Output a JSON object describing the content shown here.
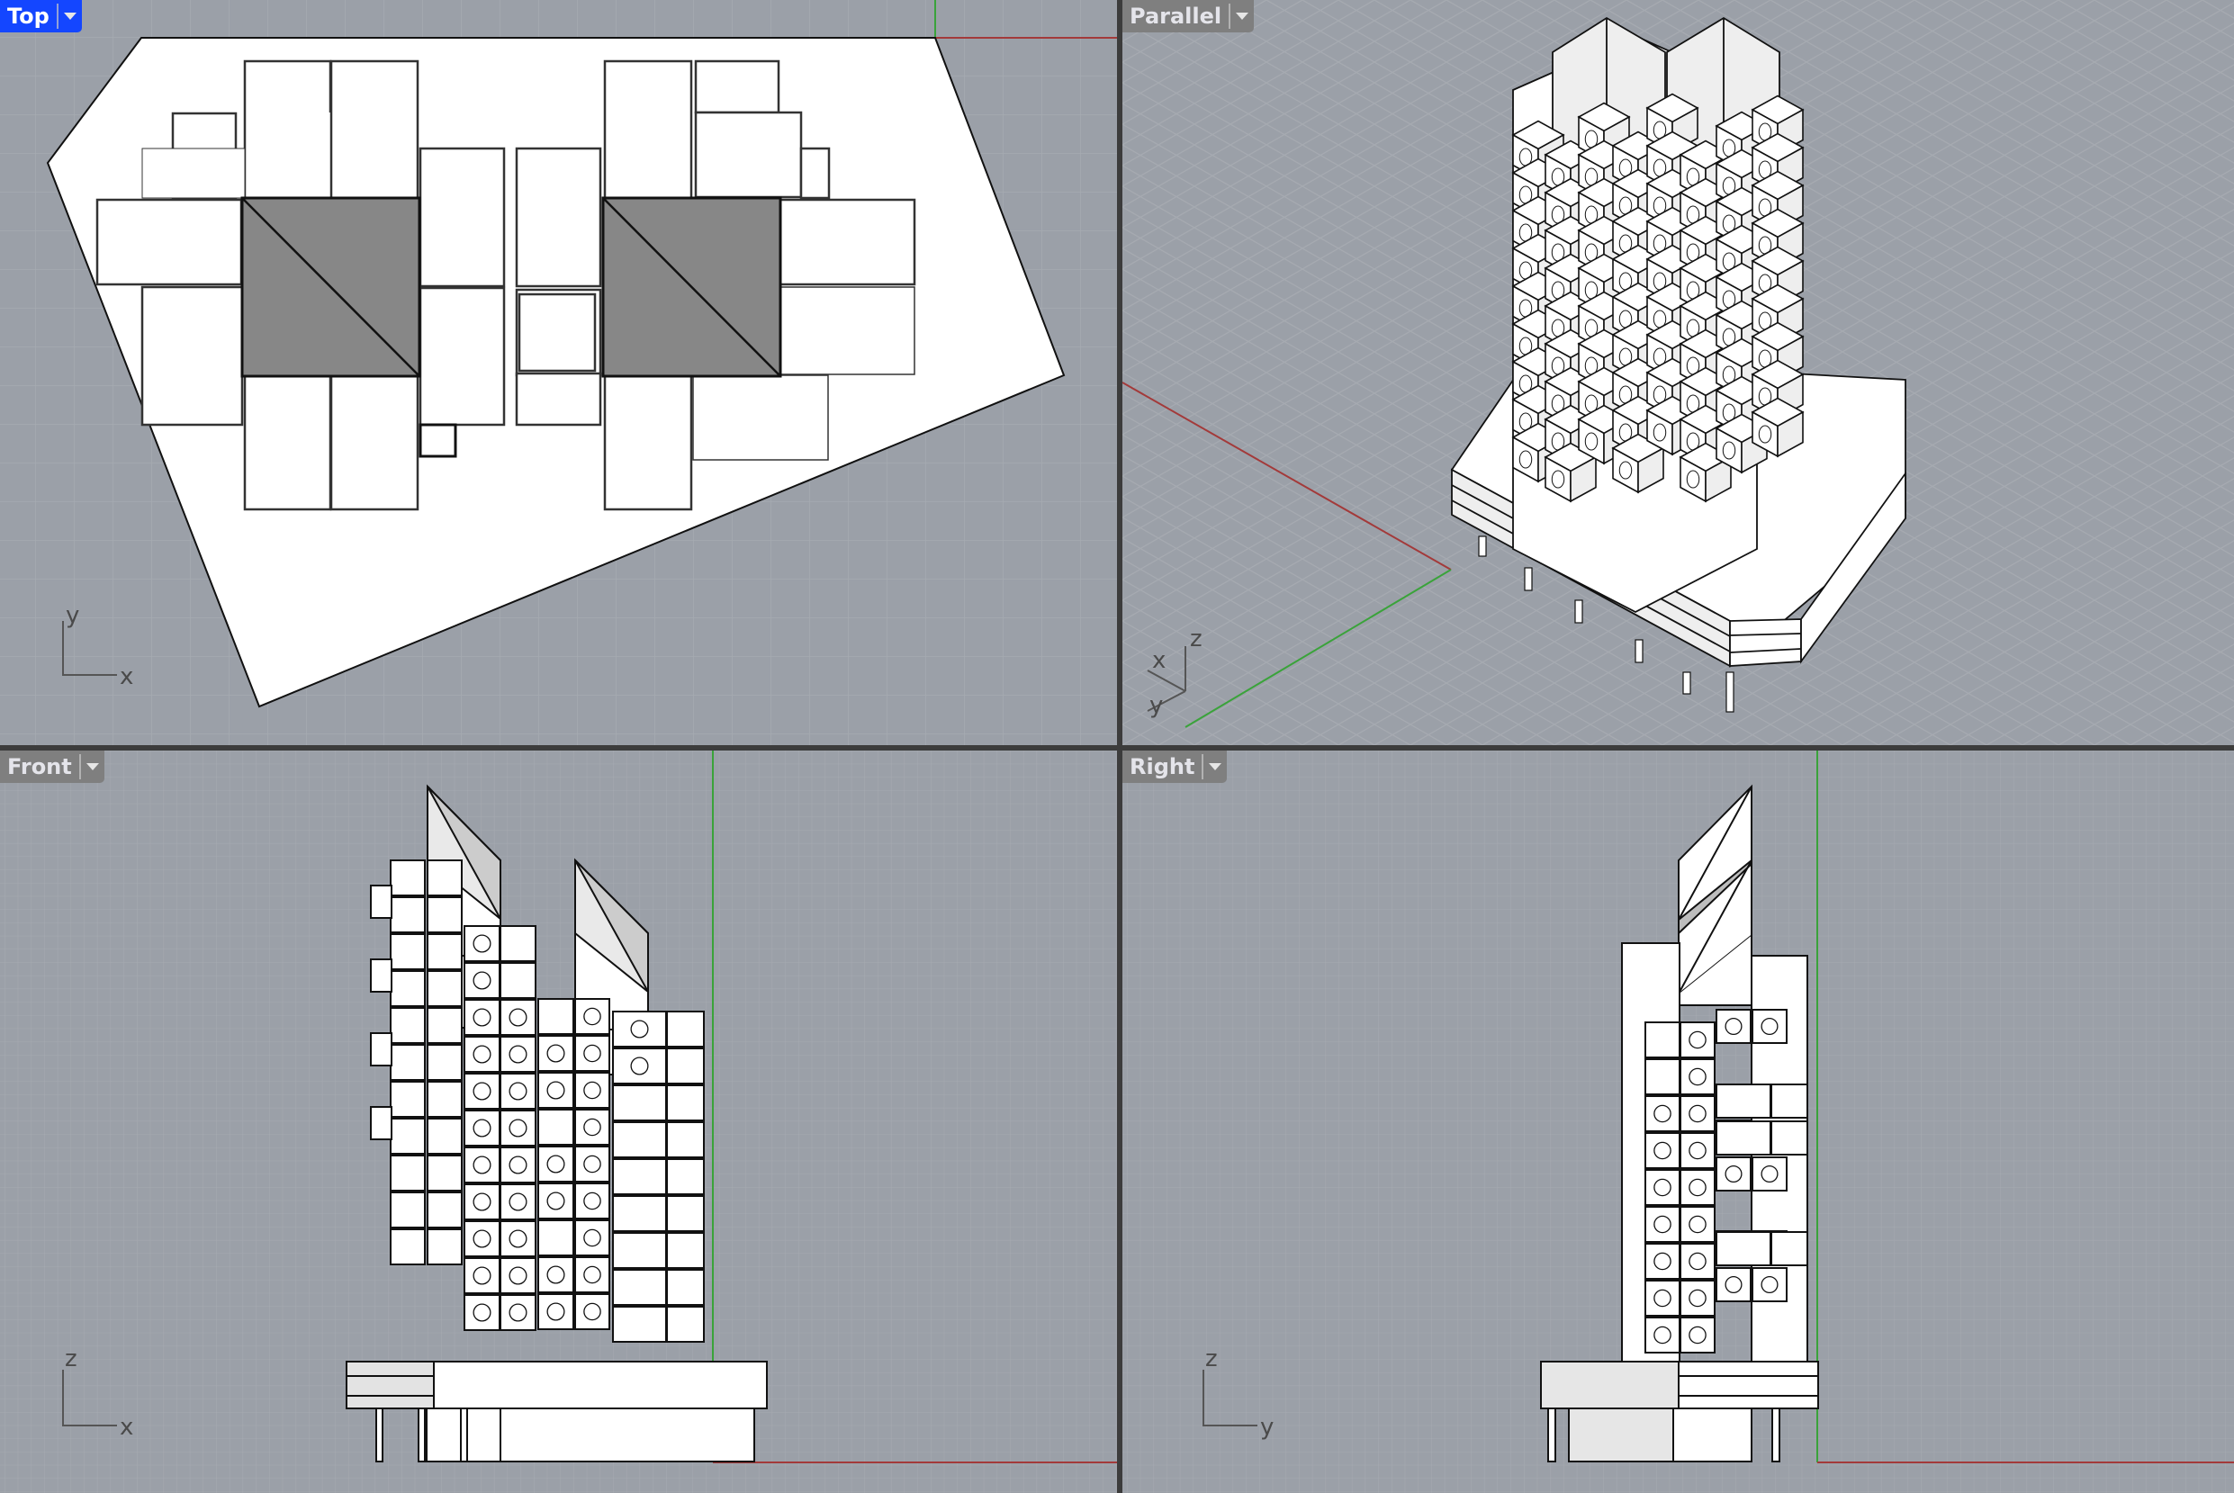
{
  "viewports": [
    {
      "id": "top",
      "label": "Top",
      "active": true,
      "axes": [
        "x",
        "y"
      ]
    },
    {
      "id": "parallel",
      "label": "Parallel",
      "active": false,
      "axes": [
        "x",
        "y",
        "z"
      ]
    },
    {
      "id": "front",
      "label": "Front",
      "active": false,
      "axes": [
        "x",
        "z"
      ]
    },
    {
      "id": "right",
      "label": "Right",
      "active": false,
      "axes": [
        "y",
        "z"
      ]
    }
  ],
  "colors": {
    "viewport_bg": "#9ba0a8",
    "grid_minor": "#a3a7ae",
    "grid_major": "#8e9299",
    "x_axis": "#a33a3a",
    "y_axis": "#3aa33a",
    "active_label": "#1446ff",
    "label_bg": "#7f7f7f",
    "shaded_core": "#878787",
    "model_fill": "#ffffff",
    "model_edge": "#111111"
  }
}
